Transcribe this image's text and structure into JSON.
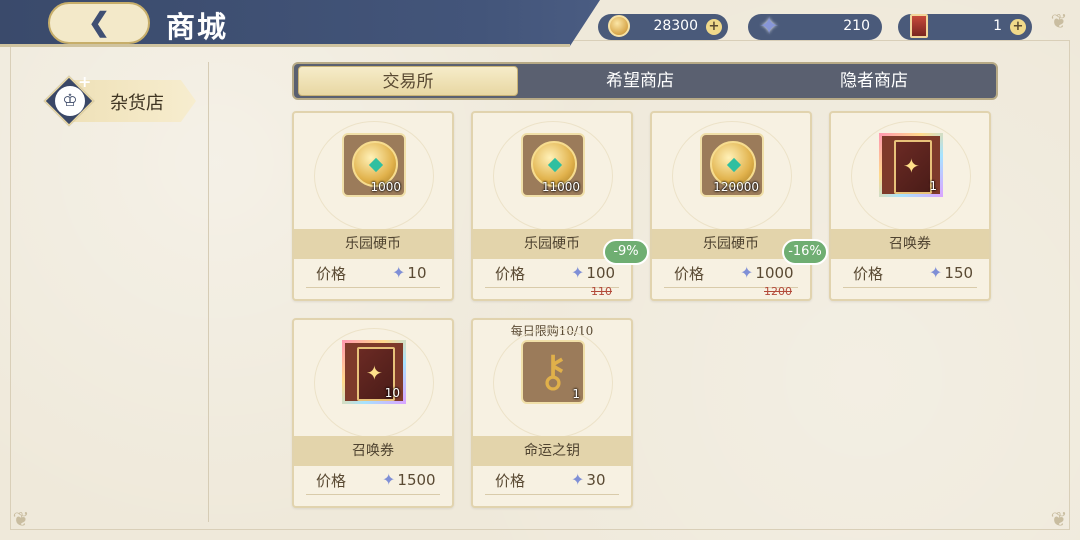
{
  "header": {
    "title": "商城",
    "back_icon": "back-arrow-icon"
  },
  "currencies": [
    {
      "icon": "coin-icon",
      "value": "28300"
    },
    {
      "icon": "star-gem-icon",
      "value": "210"
    },
    {
      "icon": "summon-ticket-icon",
      "value": "1"
    }
  ],
  "sidebar": {
    "items": [
      {
        "label": "杂货店",
        "icon": "crown-icon"
      }
    ]
  },
  "tabs": [
    {
      "label": "交易所",
      "active": true
    },
    {
      "label": "希望商店",
      "active": false
    },
    {
      "label": "隐者商店",
      "active": false
    }
  ],
  "price_label": "价格",
  "items": [
    {
      "name": "乐园硬币",
      "qty": "1000",
      "price": "10",
      "icon": "coin-icon"
    },
    {
      "name": "乐园硬币",
      "qty": "11000",
      "price": "100",
      "old_price": "110",
      "discount": "-9%",
      "icon": "coin-icon"
    },
    {
      "name": "乐园硬币",
      "qty": "120000",
      "price": "1000",
      "old_price": "1200",
      "discount": "-16%",
      "icon": "coin-icon"
    },
    {
      "name": "召唤券",
      "qty": "1",
      "price": "150",
      "icon": "summon-ticket-icon"
    },
    {
      "name": "召唤券",
      "qty": "10",
      "price": "1500",
      "icon": "summon-ticket-icon"
    },
    {
      "name": "命运之钥",
      "qty": "1",
      "price": "30",
      "limit": "每日限购10/10",
      "icon": "key-icon"
    }
  ],
  "colors": {
    "header_bg": "#43557a",
    "accent_gold": "#e1b24c",
    "discount_green": "#6fae72",
    "old_price_red": "#b34a3a"
  }
}
